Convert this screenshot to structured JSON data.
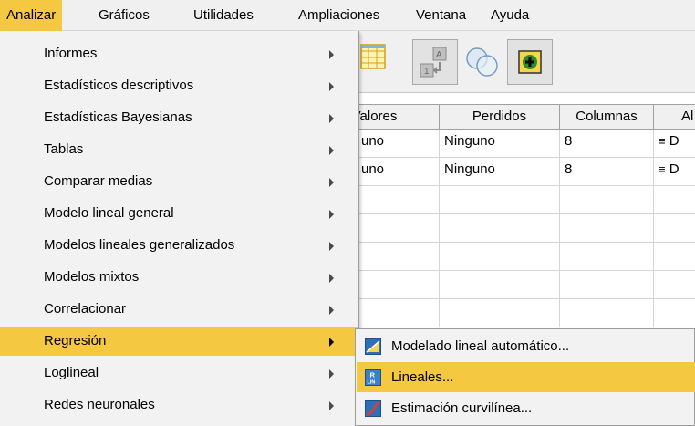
{
  "menubar": {
    "items": [
      "Analizar",
      "Gráficos",
      "Utilidades",
      "Ampliaciones",
      "Ventana",
      "Ayuda"
    ]
  },
  "grid": {
    "headers": [
      "Valores",
      "Perdidos",
      "Columnas",
      "Al"
    ],
    "rows": [
      [
        "uno",
        "Ninguno",
        "8",
        "D"
      ],
      [
        "uno",
        "Ninguno",
        "8",
        "D"
      ]
    ]
  },
  "menu": {
    "items": [
      "Informes",
      "Estadísticos descriptivos",
      "Estadísticas Bayesianas",
      "Tablas",
      "Comparar medias",
      "Modelo lineal general",
      "Modelos lineales generalizados",
      "Modelos mixtos",
      "Correlacionar",
      "Regresión",
      "Loglineal",
      "Redes neuronales"
    ],
    "highlighted": "Regresión"
  },
  "submenu": {
    "items": [
      {
        "label": "Modelado lineal automático...",
        "icon": "automatic-linear-modeling-icon"
      },
      {
        "label": "Lineales...",
        "icon": "linear-regression-icon"
      },
      {
        "label": "Estimación curvilínea...",
        "icon": "curve-estimation-icon"
      }
    ],
    "highlighted": "Lineales..."
  },
  "colors": {
    "highlight": "#f5c842",
    "menu_bg": "#f2f2f2",
    "toolbar_bg": "#f0f0f0"
  }
}
